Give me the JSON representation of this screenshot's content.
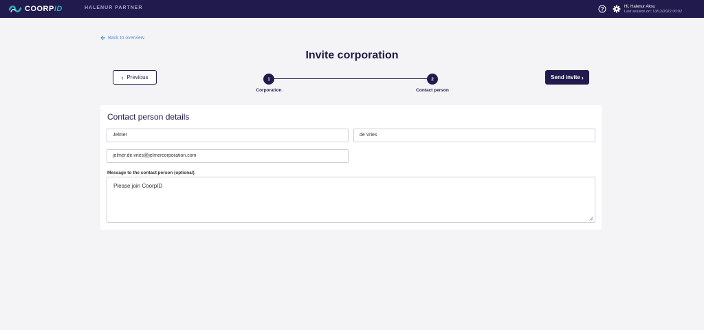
{
  "topbar": {
    "logo_main": "COORP",
    "logo_accent": "ID",
    "partner": "HALENUR PARTNER",
    "greeting": "Hi, Halenur Aksu",
    "last_session": "Last session on: 13/12/2022 00:02"
  },
  "nav": {
    "back_label": "Back to overview"
  },
  "page": {
    "title": "Invite corporation"
  },
  "actions": {
    "previous_label": "Previous",
    "send_label": "Send invite"
  },
  "steps": [
    {
      "number": "1",
      "label": "Corporation"
    },
    {
      "number": "2",
      "label": "Contact person"
    }
  ],
  "form": {
    "section_title": "Contact person details",
    "first_name": "Jelmer",
    "last_name": "de Vries",
    "email": "jelmer.de.vries@jelmercorporation.com",
    "message_label": "Message to the contact person (optional)",
    "message": "Please join CoorpID"
  },
  "colors": {
    "brand_dark": "#201a4d",
    "accent_teal": "#2bb3c0",
    "link_blue": "#5b8fd6"
  }
}
